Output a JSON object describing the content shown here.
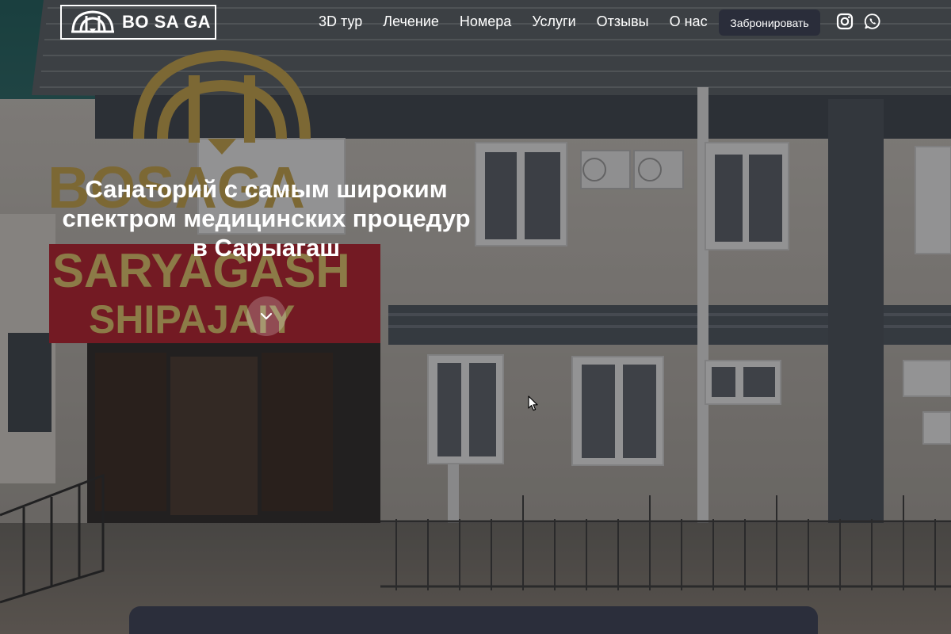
{
  "header": {
    "logo_text": "BO SA GA",
    "nav": [
      {
        "label": "3D тур"
      },
      {
        "label": "Лечение"
      },
      {
        "label": "Номера"
      },
      {
        "label": "Услуги"
      },
      {
        "label": "Отзывы"
      },
      {
        "label": "О нас"
      }
    ],
    "book_label": "Забронировать",
    "social": [
      "instagram-icon",
      "whatsapp-icon"
    ]
  },
  "hero": {
    "title_lines": [
      "Санаторий с самым широким",
      "спектром медицинских процедур",
      "в Сарыагаш"
    ],
    "scroll_icon": "chevron-down-icon"
  },
  "background_signage": {
    "brand": "BOSAGA",
    "line1": "SARYAGASH",
    "line2": "SHIPAJAIY"
  },
  "colors": {
    "accent_button": "#2a2d3a",
    "sign_gold": "#c9a54a",
    "sign_red": "#b8202e",
    "panel": "#2b2e3b"
  }
}
